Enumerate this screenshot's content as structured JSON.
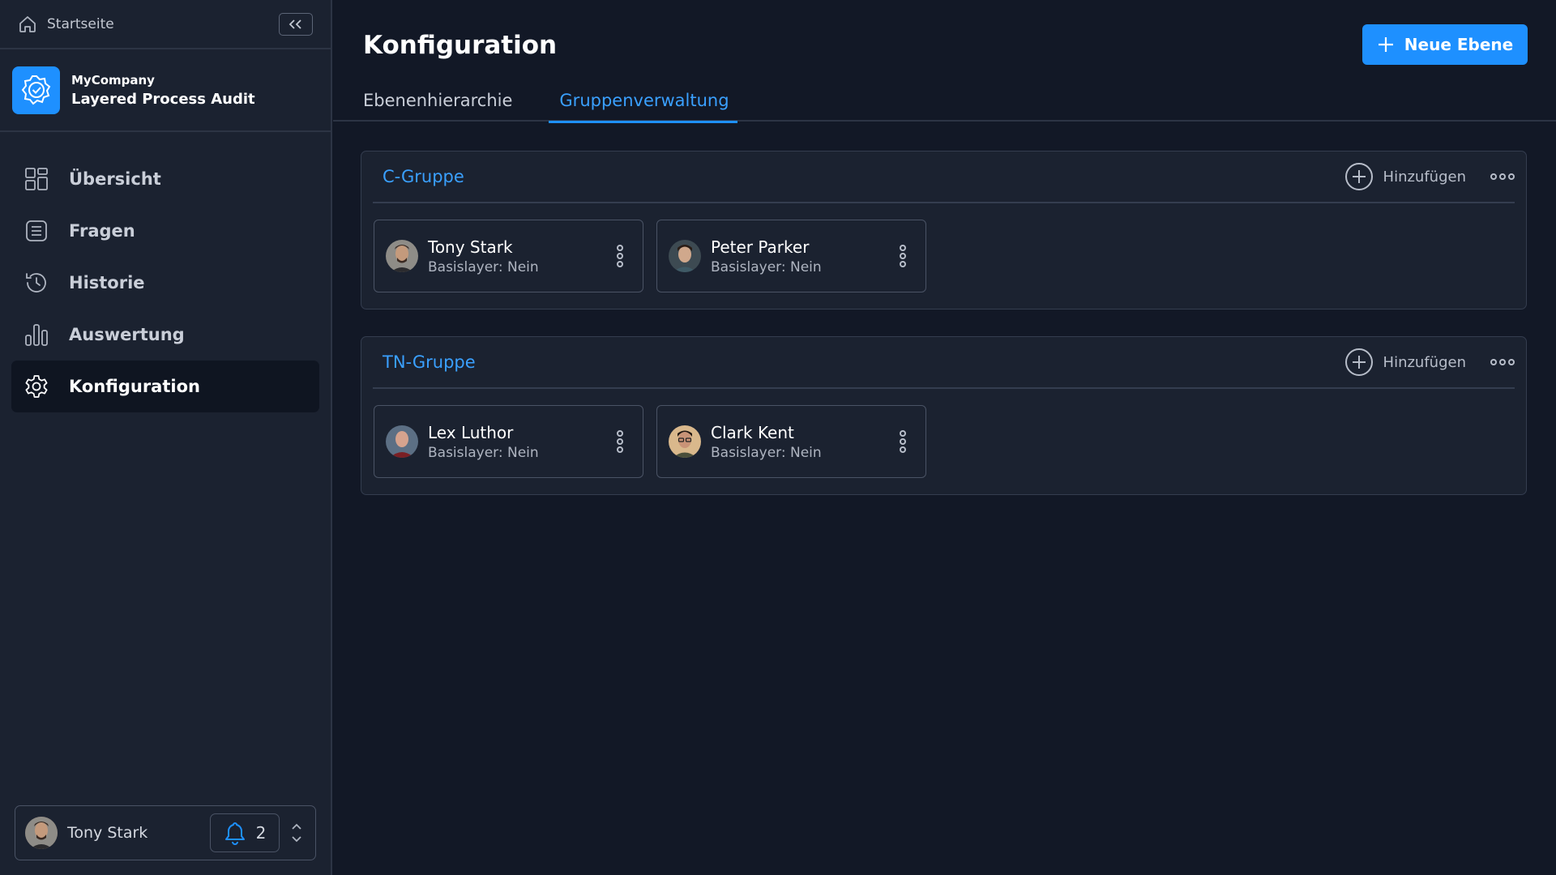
{
  "sidebar": {
    "home_label": "Startseite",
    "brand": {
      "company": "MyCompany",
      "app": "Layered Process Audit",
      "logo_icon": "badge-check-icon",
      "accent": "#1e90ff"
    },
    "items": [
      {
        "label": "Übersicht",
        "icon": "grid-icon"
      },
      {
        "label": "Fragen",
        "icon": "list-icon"
      },
      {
        "label": "Historie",
        "icon": "history-icon"
      },
      {
        "label": "Auswertung",
        "icon": "bar-chart-icon"
      },
      {
        "label": "Konfiguration",
        "icon": "gear-icon",
        "active": true
      }
    ],
    "user": {
      "name": "Tony Stark",
      "notifications": "2"
    }
  },
  "header": {
    "title": "Konfiguration",
    "primary_button": "Neue Ebene"
  },
  "tabs": [
    {
      "label": "Ebenenhierarchie"
    },
    {
      "label": "Gruppenverwaltung",
      "active": true
    }
  ],
  "groups": [
    {
      "title": "C-Gruppe",
      "add_label": "Hinzufügen",
      "members": [
        {
          "name": "Tony Stark",
          "sub": "Basislayer: Nein"
        },
        {
          "name": "Peter Parker",
          "sub": "Basislayer: Nein"
        }
      ]
    },
    {
      "title": "TN-Gruppe",
      "add_label": "Hinzufügen",
      "members": [
        {
          "name": "Lex Luthor",
          "sub": "Basislayer: Nein"
        },
        {
          "name": "Clark Kent",
          "sub": "Basislayer: Nein"
        }
      ]
    }
  ]
}
